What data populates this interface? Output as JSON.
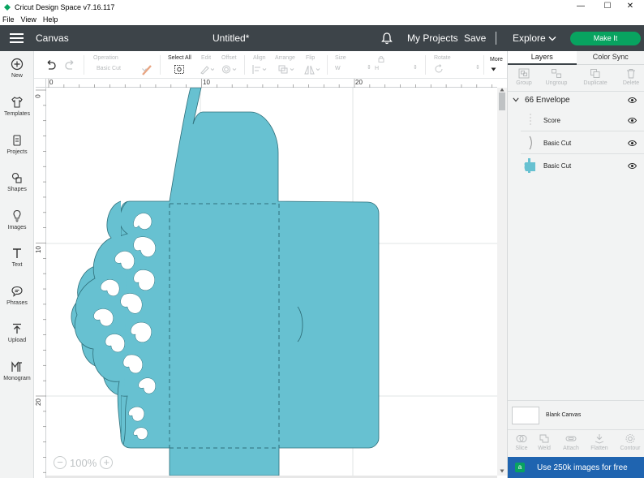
{
  "window": {
    "title": "Cricut Design Space  v7.16.117",
    "controls": [
      "—",
      "☐",
      "✕"
    ]
  },
  "menu": [
    "File",
    "View",
    "Help"
  ],
  "header": {
    "section": "Canvas",
    "doc_title": "Untitled*",
    "my_projects": "My Projects",
    "save": "Save",
    "explore": "Explore",
    "make_it": "Make It"
  },
  "sidebar": {
    "items": [
      {
        "label": "New",
        "icon": "plus-circle-icon"
      },
      {
        "label": "Templates",
        "icon": "shirt-icon"
      },
      {
        "label": "Projects",
        "icon": "projects-icon"
      },
      {
        "label": "Shapes",
        "icon": "shapes-icon"
      },
      {
        "label": "Images",
        "icon": "lightbulb-icon"
      },
      {
        "label": "Text",
        "icon": "text-icon"
      },
      {
        "label": "Phrases",
        "icon": "speech-bubble-icon"
      },
      {
        "label": "Upload",
        "icon": "upload-icon"
      },
      {
        "label": "Monogram",
        "icon": "monogram-icon"
      }
    ]
  },
  "toolbar": {
    "operation_label": "Operation",
    "operation_value": "Basic Cut",
    "select_all": "Select All",
    "edit": "Edit",
    "offset": "Offset",
    "align": "Align",
    "arrange": "Arrange",
    "flip": "Flip",
    "size": "Size",
    "size_w": "W",
    "size_h": "H",
    "rotate": "Rotate",
    "more": "More"
  },
  "rulers": {
    "top": [
      "0",
      "10",
      "20"
    ],
    "left": [
      "0",
      "10",
      "20"
    ]
  },
  "zoom": {
    "minus": "−",
    "value": "100%",
    "plus": "+"
  },
  "right_panel": {
    "tabs": [
      "Layers",
      "Color Sync"
    ],
    "layer_tools": [
      "Group",
      "Ungroup",
      "Duplicate",
      "Delete"
    ],
    "group_name": "66 Envelope",
    "layers": [
      {
        "label": "Score"
      },
      {
        "label": "Basic Cut"
      },
      {
        "label": "Basic Cut"
      }
    ],
    "blank_canvas": "Blank Canvas",
    "bottom_tools": [
      "Slice",
      "Weld",
      "Attach",
      "Flatten",
      "Contour"
    ],
    "promo_badge": "a",
    "promo": "Use 250k images for free"
  },
  "colors": {
    "header_bg": "#3d4449",
    "make_it": "#08a360",
    "envelope": "#67c1d1",
    "promo_bg": "#1f64b0"
  }
}
